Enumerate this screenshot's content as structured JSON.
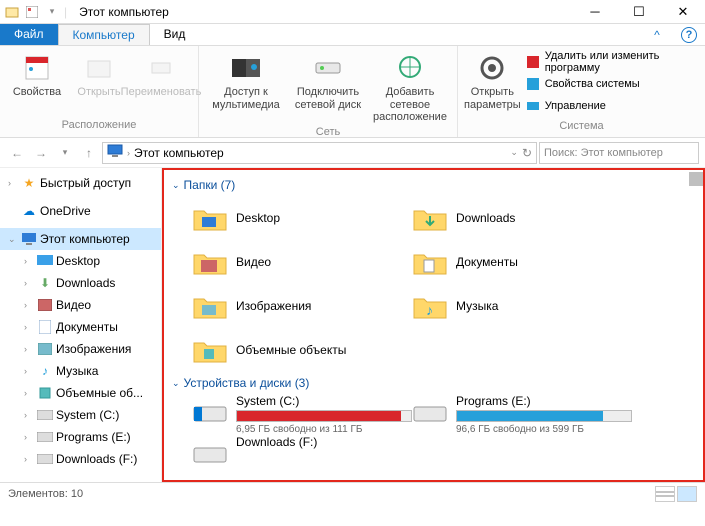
{
  "window": {
    "title": "Этот компьютер"
  },
  "tabs": {
    "file": "Файл",
    "computer": "Компьютер",
    "view": "Вид"
  },
  "ribbon": {
    "props": "Свойства",
    "open": "Открыть",
    "rename": "Переименовать",
    "group_location": "Расположение",
    "media": "Доступ к мультимедиа",
    "netdrive": "Подключить сетевой диск",
    "netloc": "Добавить сетевое расположение",
    "group_network": "Сеть",
    "settings": "Открыть параметры",
    "sys_uninstall": "Удалить или изменить программу",
    "sys_props": "Свойства системы",
    "sys_manage": "Управление",
    "group_system": "Система"
  },
  "address": {
    "path": "Этот компьютер"
  },
  "search": {
    "placeholder": "Поиск: Этот компьютер"
  },
  "tree": {
    "quick": "Быстрый доступ",
    "onedrive": "OneDrive",
    "thispc": "Этот компьютер",
    "desktop": "Desktop",
    "downloads": "Downloads",
    "videos": "Видео",
    "documents": "Документы",
    "pictures": "Изображения",
    "music": "Музыка",
    "objects3d": "Объемные об...",
    "system_c": "System (C:)",
    "programs_e": "Programs (E:)",
    "downloads_f": "Downloads (F:)"
  },
  "sections": {
    "folders": "Папки (7)",
    "drives": "Устройства и диски (3)"
  },
  "folders": {
    "desktop": "Desktop",
    "downloads": "Downloads",
    "videos": "Видео",
    "documents": "Документы",
    "pictures": "Изображения",
    "music": "Музыка",
    "objects3d": "Объемные объекты"
  },
  "drives": {
    "c": {
      "name": "System (C:)",
      "caption": "6,95 ГБ свободно из 111 ГБ",
      "fill": 94,
      "color": "#d9262c"
    },
    "e": {
      "name": "Programs (E:)",
      "caption": "96,6 ГБ свободно из 599 ГБ",
      "fill": 84,
      "color": "#26a0da"
    },
    "f": {
      "name": "Downloads (F:)"
    }
  },
  "status": {
    "elements": "Элементов: 10"
  }
}
